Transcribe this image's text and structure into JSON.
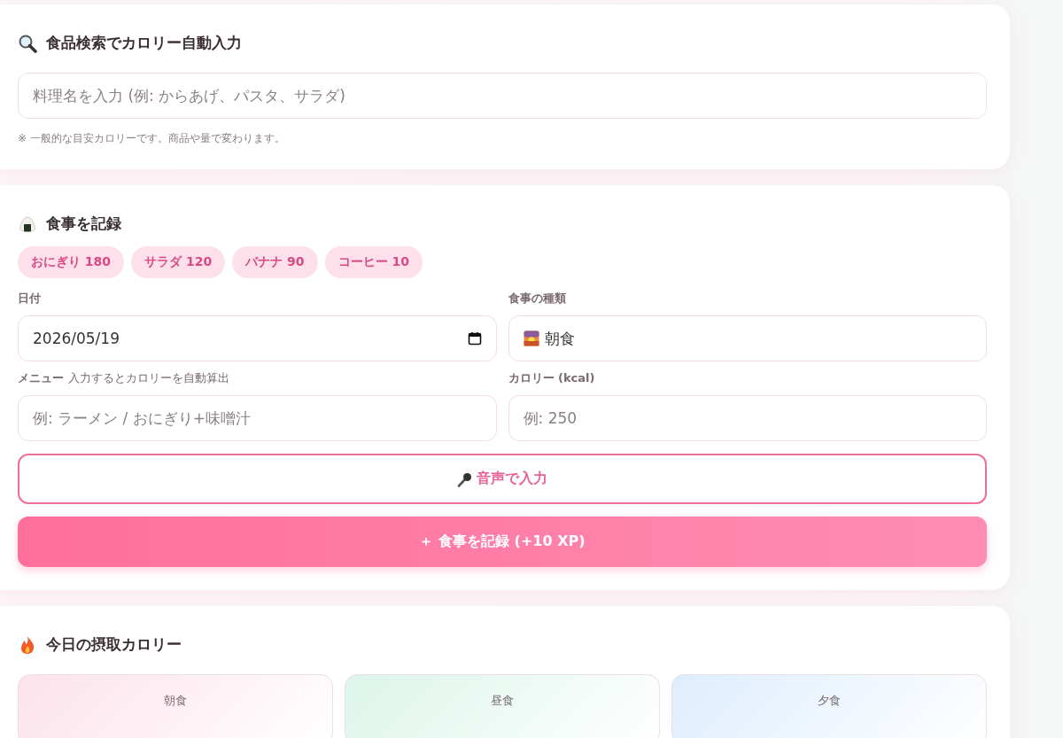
{
  "search_card": {
    "title": "食品検索でカロリー自動入力",
    "search": {
      "placeholder": "料理名を入力 (例: からあげ、パスタ、サラダ)"
    },
    "note": "※ 一般的な目安カロリーです。商品や量で変わります。"
  },
  "record_card": {
    "title": "食事を記録",
    "presets": [
      {
        "label": "おにぎり 180"
      },
      {
        "label": "サラダ 120"
      },
      {
        "label": "バナナ 90"
      },
      {
        "label": "コーヒー 10"
      }
    ],
    "date": {
      "label": "日付",
      "value": "2026/05/19"
    },
    "meal_type": {
      "label": "食事の種類",
      "value": "朝食"
    },
    "menu": {
      "label": "メニュー",
      "hint": "入力するとカロリーを自動算出",
      "placeholder": "例: ラーメン / おにぎり+味噌汁"
    },
    "calories": {
      "label": "カロリー (kcal)",
      "placeholder": "例: 250"
    },
    "voice_button": "音声で入力",
    "submit_button": "＋ 食事を記録 (+10 XP)"
  },
  "today_card": {
    "title": "今日の摂取カロリー",
    "meals": [
      {
        "label": "朝食",
        "color": "#fde2ec"
      },
      {
        "label": "昼食",
        "color": "#dcf5ea"
      },
      {
        "label": "夕食",
        "color": "#deedfd"
      }
    ]
  }
}
